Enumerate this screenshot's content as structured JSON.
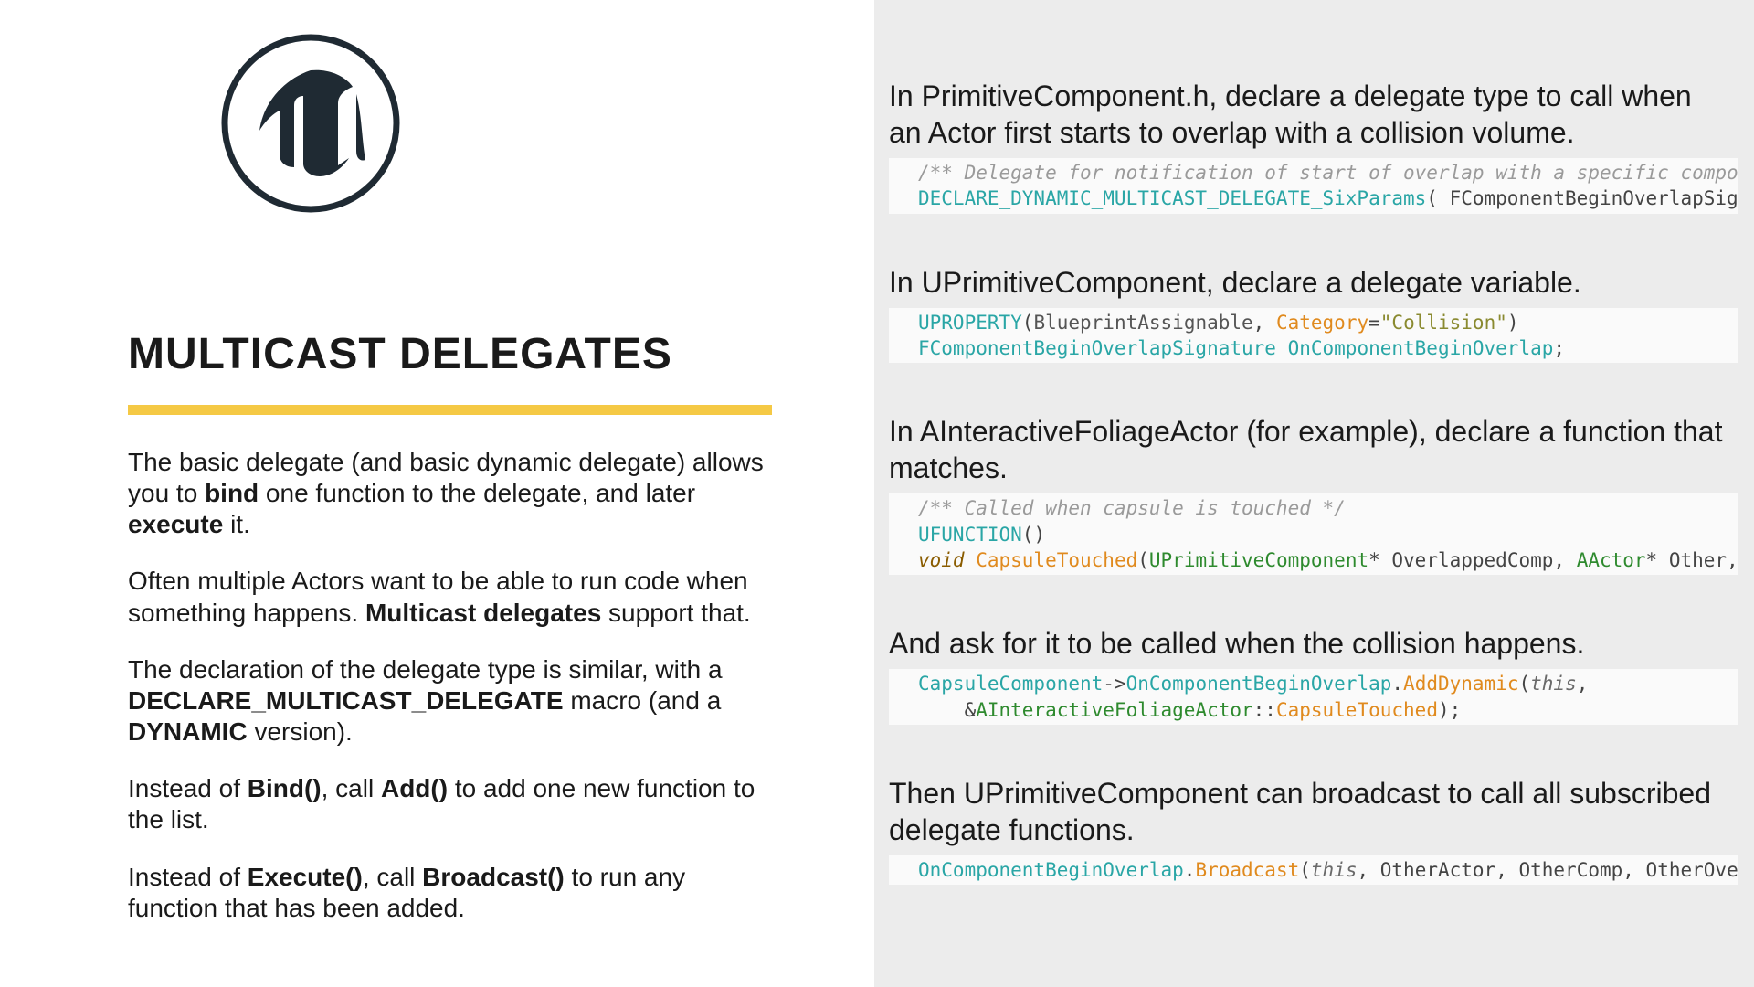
{
  "left": {
    "title": "MULTICAST DELEGATES",
    "para1_pre": "The basic delegate (and basic dynamic delegate) allows you to ",
    "para1_b1": "bind",
    "para1_mid": " one function to the delegate, and later ",
    "para1_b2": "execute",
    "para1_post": " it.",
    "para2_pre": "Often multiple Actors want to be able to run code when something happens. ",
    "para2_b1": "Multicast delegates",
    "para2_post": " support that.",
    "para3_pre": "The declaration of the delegate type is similar, with a ",
    "para3_b1": "DECLARE_MULTICAST_DELEGATE",
    "para3_mid": " macro (and a ",
    "para3_b2": "DYNAMIC",
    "para3_post": " version).",
    "para4_pre": "Instead of ",
    "para4_b1": "Bind()",
    "para4_mid": ", call ",
    "para4_b2": "Add()",
    "para4_post": " to add one new function to the list.",
    "para5_pre": "Instead of ",
    "para5_b1": "Execute()",
    "para5_mid": ", call ",
    "para5_b2": "Broadcast()",
    "para5_post": " to run any function that has been added."
  },
  "right": {
    "sec1": "In PrimitiveComponent.h, declare a delegate type to call when an Actor first starts to overlap with a collision volume.",
    "code1_comment": "/** Delegate for notification of start of overlap with a specific component */",
    "code1_macro": "DECLARE_DYNAMIC_MULTICAST_DELEGATE_SixParams",
    "code1_rest": "( FComponentBeginOverlapSignature, UPr",
    "sec2": "In UPrimitiveComponent, declare a delegate variable.",
    "code2_uprop": "UPROPERTY",
    "code2_args_open": "(",
    "code2_arg1": "BlueprintAssignable",
    "code2_comma": ", ",
    "code2_cat": "Category",
    "code2_eq": "=",
    "code2_str": "\"Collision\"",
    "code2_close": ")",
    "code2_type": "FComponentBeginOverlapSignature",
    "code2_var": " OnComponentBeginOverlap",
    "code2_semi": ";",
    "sec3": "In AInteractiveFoliageActor (for example), declare a function that matches.",
    "code3_comment": "/** Called when capsule is touched */",
    "code3_ufunc": "UFUNCTION",
    "code3_ufunc_p": "()",
    "code3_void": "void",
    "code3_fn": " CapsuleTouched",
    "code3_open": "(",
    "code3_p1type": "UPrimitiveComponent",
    "code3_p1rest": "* OverlappedComp, ",
    "code3_p2type": "AActor",
    "code3_p2rest": "* Other, UPrimit",
    "sec4": "And ask for it to be called when the collision happens.",
    "code4_a": "CapsuleComponent",
    "code4_arrow": "->",
    "code4_b": "OnComponentBeginOverlap",
    "code4_dot1": ".",
    "code4_add": "AddDynamic",
    "code4_open": "(",
    "code4_this": "this",
    "code4_comma": ",",
    "code4_line2_indent": "    &",
    "code4_cls": "AInteractiveFoliageActor",
    "code4_scope": "::",
    "code4_fn": "CapsuleTouched",
    "code4_close": ");",
    "sec5": "Then UPrimitiveComponent can broadcast to call all subscribed delegate functions.",
    "code5_a": "OnComponentBeginOverlap",
    "code5_dot": ".",
    "code5_b": "Broadcast",
    "code5_open": "(",
    "code5_this": "this",
    "code5_rest": ", OtherActor, OtherComp, OtherOverlap.Get"
  }
}
